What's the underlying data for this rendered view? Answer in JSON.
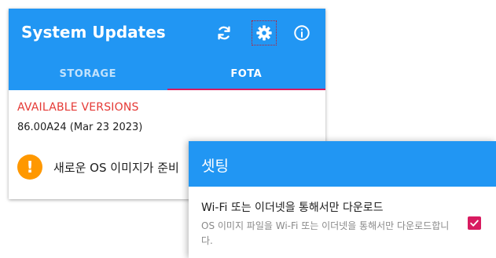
{
  "colors": {
    "primary": "#2196f3",
    "indicator": "#d81b60",
    "alert": "#e53935",
    "warning": "#ff9800"
  },
  "app": {
    "title": "System Updates",
    "toolbar_icons": [
      "sync-icon",
      "gear-icon",
      "info-icon"
    ],
    "tabs": [
      {
        "label": "STORAGE",
        "active": false
      },
      {
        "label": "FOTA",
        "active": true
      }
    ],
    "section_label": "AVAILABLE VERSIONS",
    "version": "86.00A24 (Mar 23 2023)",
    "notice": {
      "icon": "exclamation-icon",
      "text": "새로운 OS 이미지가 준비"
    }
  },
  "settings": {
    "title": "셋팅",
    "preference": {
      "title": "Wi-Fi 또는 이더넷을 통해서만 다운로드",
      "summary": "OS 이미지 파일을 Wi-Fi 또는 이더넷을 통해서만 다운로드합니다.",
      "checked": true
    }
  }
}
